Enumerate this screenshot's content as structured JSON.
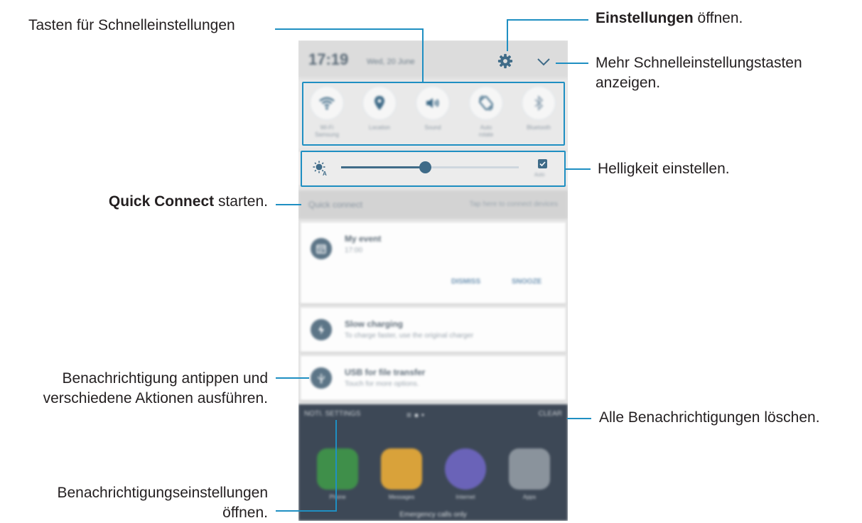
{
  "callouts": {
    "quick_settings": "Tasten für Schnelleinstellungen",
    "settings_bold": "Einstellungen",
    "settings_rest": " öffnen.",
    "more_line1": "Mehr Schnelleinstellungstasten",
    "more_line2": "anzeigen.",
    "brightness": "Helligkeit einstellen.",
    "qc_bold": "Quick Connect",
    "qc_rest": " starten.",
    "tap_line1": "Benachrichtigung antippen und",
    "tap_line2": "verschiedene Aktionen ausführen.",
    "clear_all": "Alle Benachrichtigungen löschen.",
    "notif_line1": "Benachrichtigungseinstellungen",
    "notif_line2": "öffnen."
  },
  "status_bar": {
    "time": "17:19",
    "date": "Wed, 20 June"
  },
  "quick_buttons": [
    {
      "icon": "wifi-icon",
      "label": "Wi-Fi",
      "sub": "Samsung"
    },
    {
      "icon": "location-icon",
      "label": "Location",
      "sub": ""
    },
    {
      "icon": "sound-icon",
      "label": "Sound",
      "sub": ""
    },
    {
      "icon": "auto-rotate-icon",
      "label": "Auto",
      "sub": "rotate"
    },
    {
      "icon": "bluetooth-icon",
      "label": "Bluetooth",
      "sub": ""
    }
  ],
  "brightness": {
    "level": 0.47,
    "auto_label": "Auto",
    "auto_checked": true
  },
  "quick_connect": {
    "label": "Quick connect",
    "hint": "Tap here to connect devices"
  },
  "notifications": [
    {
      "icon": "calendar-icon",
      "title": "My event",
      "sub": "17:00",
      "actions": [
        "DISMISS",
        "SNOOZE"
      ]
    },
    {
      "icon": "charging-icon",
      "title": "Slow charging",
      "sub": "To charge faster, use the original charger"
    },
    {
      "icon": "usb-icon",
      "title": "USB for file transfer",
      "sub": "Touch for more options."
    }
  ],
  "footer": {
    "settings": "NOTI. SETTINGS",
    "clear": "CLEAR"
  },
  "home_apps": [
    {
      "label": "Phone",
      "color": "#3f8f4a"
    },
    {
      "label": "Messages",
      "color": "#d9a23a"
    },
    {
      "label": "Internet",
      "color": "#6a63b8"
    },
    {
      "label": "Apps",
      "color": "#8a939c"
    }
  ],
  "emergency": "Emergency calls only",
  "colors": {
    "accent_line": "#1f8fc2",
    "icon_blue": "#3f6b88"
  }
}
